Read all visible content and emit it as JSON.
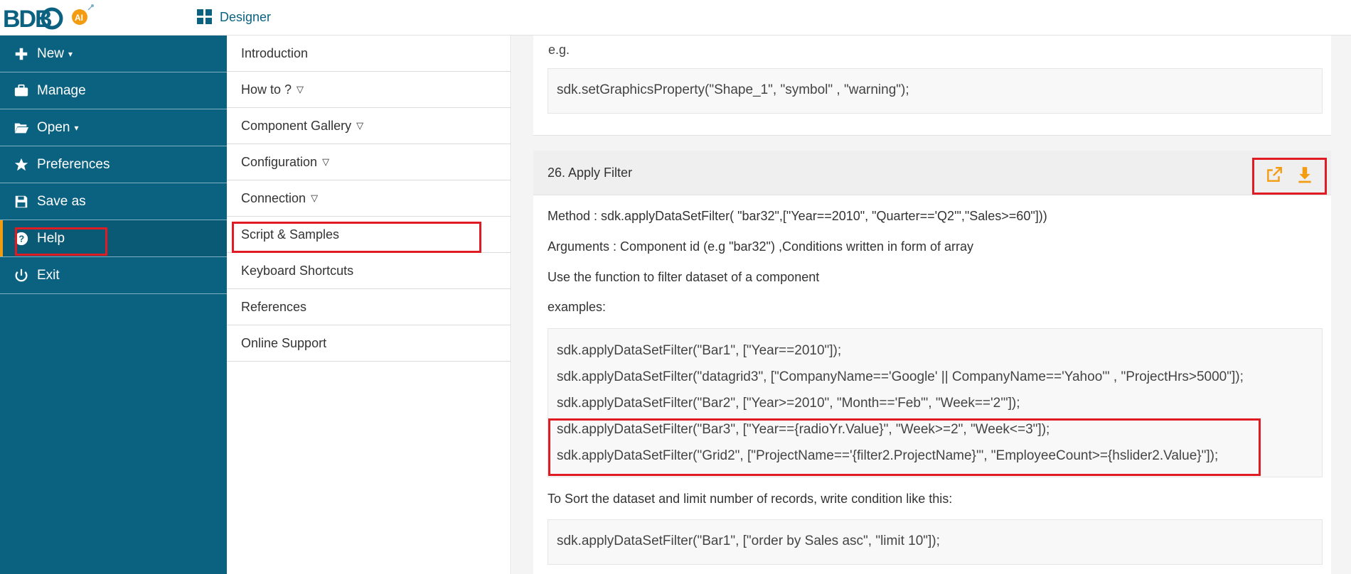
{
  "brand": {
    "logo_text": "BDB",
    "logo_badge": "AI"
  },
  "topbar": {
    "designer_label": "Designer"
  },
  "sidebar": {
    "items": [
      {
        "label": "New",
        "icon": "plus-icon",
        "dropdown": true
      },
      {
        "label": "Manage",
        "icon": "briefcase-icon",
        "dropdown": false
      },
      {
        "label": "Open",
        "icon": "folder-open-icon",
        "dropdown": true
      },
      {
        "label": "Preferences",
        "icon": "star-icon",
        "dropdown": false
      },
      {
        "label": "Save as",
        "icon": "save-icon",
        "dropdown": false
      },
      {
        "label": "Help",
        "icon": "help-circle-icon",
        "dropdown": false,
        "active": true
      },
      {
        "label": "Exit",
        "icon": "power-icon",
        "dropdown": false
      }
    ]
  },
  "help_menu": {
    "items": [
      {
        "label": "Introduction"
      },
      {
        "label": "How to ?",
        "expand": "▽"
      },
      {
        "label": "Component Gallery",
        "expand": "▽"
      },
      {
        "label": "Configuration",
        "expand": "▽"
      },
      {
        "label": "Connection",
        "expand": "▽"
      },
      {
        "label": "Script & Samples"
      },
      {
        "label": "Keyboard Shortcuts"
      },
      {
        "label": "References"
      },
      {
        "label": "Online Support"
      }
    ]
  },
  "content": {
    "prev_card": {
      "eg_label": "e.g.",
      "code": "sdk.setGraphicsProperty(\"Shape_1\", \"symbol\" , \"warning\");"
    },
    "card": {
      "title": "26. Apply Filter",
      "actions": [
        "open-external-icon",
        "download-icon"
      ],
      "method": "Method : sdk.applyDataSetFilter( \"bar32\",[\"Year==2010\", \"Quarter=='Q2'\",\"Sales>=60\"]))",
      "arguments": "Arguments : Component id (e.g \"bar32\") ,Conditions written in form of array",
      "description": "Use the function to filter dataset of a component",
      "examples_label": "examples:",
      "examples": [
        "sdk.applyDataSetFilter(\"Bar1\", [\"Year==2010\"]);",
        "sdk.applyDataSetFilter(\"datagrid3\", [\"CompanyName=='Google' || CompanyName=='Yahoo'\" , \"ProjectHrs>5000\"]);",
        "sdk.applyDataSetFilter(\"Bar2\", [\"Year>=2010\", \"Month=='Feb'\", \"Week=='2'\"]);",
        "sdk.applyDataSetFilter(\"Bar3\", [\"Year=={radioYr.Value}\", \"Week>=2\", \"Week<=3\"]);",
        "sdk.applyDataSetFilter(\"Grid2\", [\"ProjectName=='{filter2.ProjectName}'\", \"EmployeeCount>={hslider2.Value}\"]);"
      ],
      "sort_note": "To Sort the dataset and limit number of records, write condition like this:",
      "sort_code": "sdk.applyDataSetFilter(\"Bar1\", [\"order by Sales asc\", \"limit 10\"]);"
    }
  },
  "colors": {
    "sidebar_bg": "#0b6280",
    "accent": "#f39c12",
    "highlight": "#e01b24"
  }
}
